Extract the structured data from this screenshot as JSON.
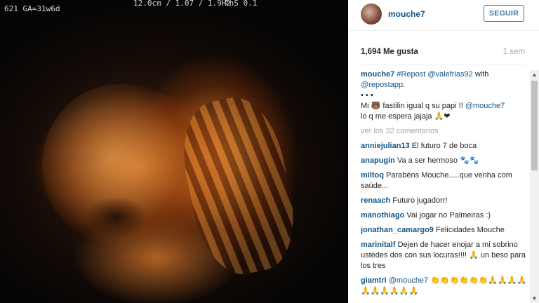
{
  "photo": {
    "overlay_left": "621 GA=31w6d",
    "overlay_center": "12.0cm / 1.07 / 1.9Hz",
    "overlay_right": "ThS 0.1"
  },
  "header": {
    "username": "mouche7",
    "follow_label": "SEGUIR"
  },
  "stats": {
    "likes": "1,694 Me gusta",
    "time": "1 sem"
  },
  "caption": {
    "user": "mouche7",
    "line1_text": "#Repost",
    "line1_mention": "@valefrias92",
    "line1_with": "with",
    "line2_mention": "@repostapp",
    "line2_dot": ".",
    "dots": "• • •",
    "line3_a": "Mi 🐻 fastilin igual q su papi !!",
    "line3_mention": "@mouche7",
    "line4": "lo q me espera jajaja 🙏❤"
  },
  "view_more": "ver los 32 comentarios",
  "comments": [
    {
      "user": "anniejulian13",
      "text": "El futuro 7 de boca"
    },
    {
      "user": "anapugin",
      "text": "Va a ser hermoso 🐾🐾"
    },
    {
      "user": "miltoq",
      "text": "Parabéns Mouche.....que venha com saúde..."
    },
    {
      "user": "renaach",
      "text": "Futuro jugadorr!"
    },
    {
      "user": "manothiago",
      "text": "Vai jogar no Palmeiras :)"
    },
    {
      "user": "jonathan_camargo9",
      "text": "Felicidades Mouche"
    },
    {
      "user": "marinitalf",
      "text": "Dejen de hacer enojar a mi sobrino ustedes dos con sus locuras!!!! 🙏 un beso para los tres"
    },
    {
      "user": "giamtri",
      "mention": "@mouche7",
      "text": "👏👏👏👏👏👏🙏🙏🙏🙏🙏🙏🙏🙏🙏🙏"
    }
  ],
  "scrollbar": {
    "up_arrow": "▲",
    "down_arrow": "▼"
  }
}
